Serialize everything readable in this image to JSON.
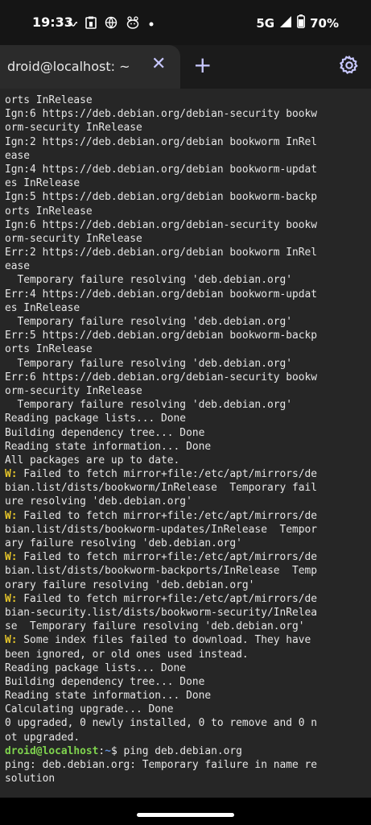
{
  "status_bar": {
    "time": "19:33",
    "network": "5G",
    "battery": "70%",
    "icons": [
      "wave-icon",
      "clipboard-icon",
      "globe-icon",
      "pet-icon",
      "dot-icon",
      "signal-icon",
      "battery-icon"
    ]
  },
  "tab": {
    "title": "droid@localhost: ~",
    "close_glyph": "✕",
    "add_glyph": "+"
  },
  "colors": {
    "accent": "#c8c8ff",
    "warning": "#e5c52a",
    "prompt_user": "#7fd34e",
    "prompt_path": "#5f8dd6",
    "terminal_bg": "#262626"
  },
  "terminal": {
    "lines": [
      "orts InRelease",
      "Ign:6 https://deb.debian.org/debian-security bookw",
      "orm-security InRelease",
      "Ign:2 https://deb.debian.org/debian bookworm InRel",
      "ease",
      "Ign:4 https://deb.debian.org/debian bookworm-updat",
      "es InRelease",
      "Ign:5 https://deb.debian.org/debian bookworm-backp",
      "orts InRelease",
      "Ign:6 https://deb.debian.org/debian-security bookw",
      "orm-security InRelease",
      "Err:2 https://deb.debian.org/debian bookworm InRel",
      "ease",
      "  Temporary failure resolving 'deb.debian.org'",
      "Err:4 https://deb.debian.org/debian bookworm-updat",
      "es InRelease",
      "  Temporary failure resolving 'deb.debian.org'",
      "Err:5 https://deb.debian.org/debian bookworm-backp",
      "orts InRelease",
      "  Temporary failure resolving 'deb.debian.org'",
      "Err:6 https://deb.debian.org/debian-security bookw",
      "orm-security InRelease",
      "  Temporary failure resolving 'deb.debian.org'",
      "Reading package lists... Done",
      "Building dependency tree... Done",
      "Reading state information... Done",
      "All packages are up to date.",
      "W: Failed to fetch mirror+file:/etc/apt/mirrors/de",
      "bian.list/dists/bookworm/InRelease  Temporary fail",
      "ure resolving 'deb.debian.org'",
      "W: Failed to fetch mirror+file:/etc/apt/mirrors/de",
      "bian.list/dists/bookworm-updates/InRelease  Tempor",
      "ary failure resolving 'deb.debian.org'",
      "W: Failed to fetch mirror+file:/etc/apt/mirrors/de",
      "bian.list/dists/bookworm-backports/InRelease  Temp",
      "orary failure resolving 'deb.debian.org'",
      "W: Failed to fetch mirror+file:/etc/apt/mirrors/de",
      "bian-security.list/dists/bookworm-security/InRelea",
      "se  Temporary failure resolving 'deb.debian.org'",
      "W: Some index files failed to download. They have",
      "been ignored, or old ones used instead.",
      "Reading package lists... Done",
      "Building dependency tree... Done",
      "Reading state information... Done",
      "Calculating upgrade... Done",
      "0 upgraded, 0 newly installed, 0 to remove and 0 n",
      "ot upgraded."
    ],
    "prompt": {
      "user": "droid@localhost",
      "sep": ":",
      "path": "~",
      "symbol": "$ ",
      "command": "ping deb.debian.org"
    },
    "output": [
      "ping: deb.debian.org: Temporary failure in name re",
      "solution"
    ]
  }
}
